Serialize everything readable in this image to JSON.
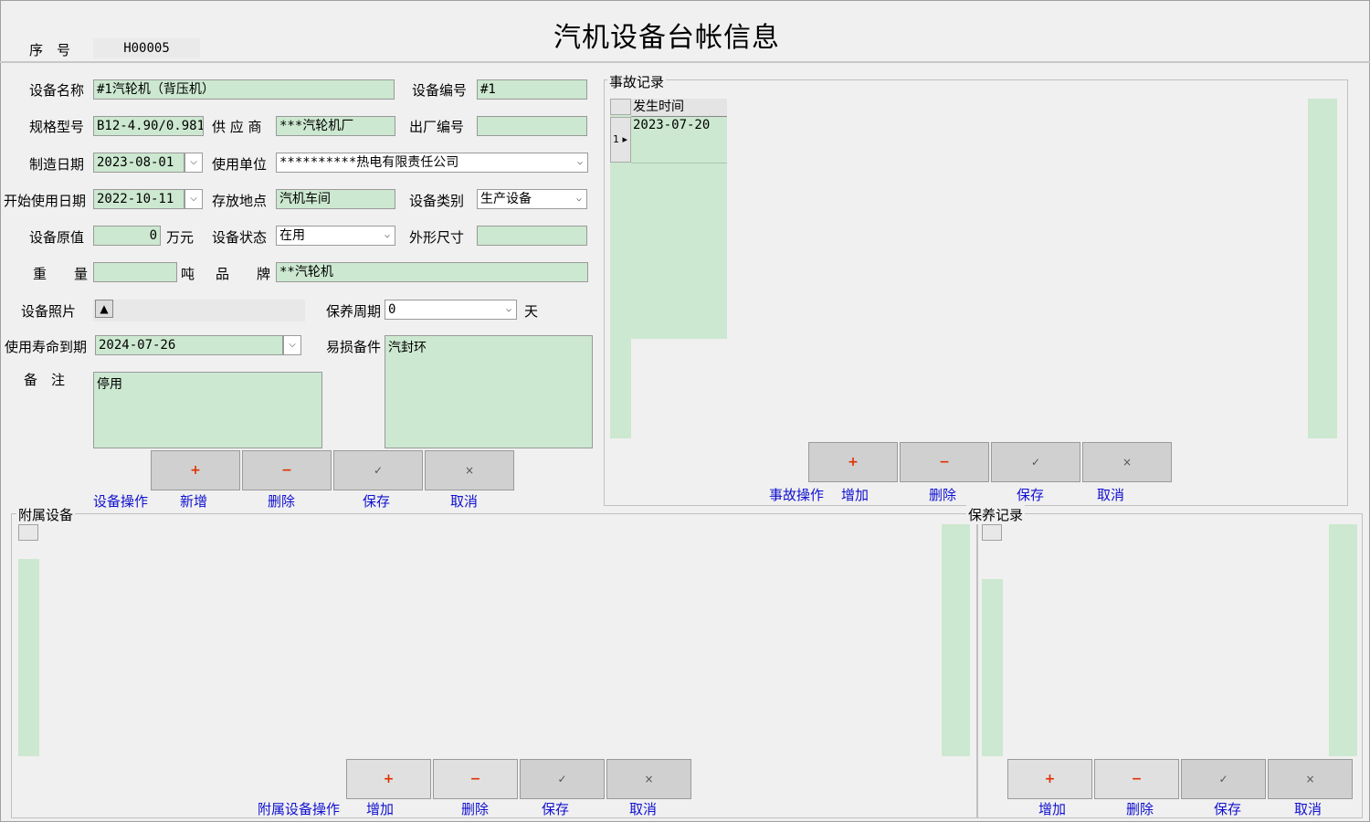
{
  "title": "汽机设备台帐信息",
  "seq": {
    "label": "序　号",
    "value": "H00005"
  },
  "form": {
    "device_name": {
      "label": "设备名称",
      "value": "#1汽轮机（背压机）"
    },
    "device_no": {
      "label": "设备编号",
      "value": "#1"
    },
    "spec": {
      "label": "规格型号",
      "value": "B12-4.90/0.981"
    },
    "supplier": {
      "label": "供 应 商",
      "value": "***汽轮机厂"
    },
    "factory_no": {
      "label": "出厂编号",
      "value": ""
    },
    "mfg_date": {
      "label": "制造日期",
      "value": "2023-08-01"
    },
    "use_unit": {
      "label": "使用单位",
      "value": "**********热电有限责任公司"
    },
    "start_date": {
      "label": "开始使用日期",
      "value": "2022-10-11"
    },
    "location": {
      "label": "存放地点",
      "value": "汽机车间"
    },
    "category": {
      "label": "设备类别",
      "value": "生产设备"
    },
    "orig_value": {
      "label": "设备原值",
      "value": "0",
      "unit": "万元"
    },
    "status": {
      "label": "设备状态",
      "value": "在用"
    },
    "dimensions": {
      "label": "外形尺寸",
      "value": ""
    },
    "weight": {
      "label": "重　　量",
      "value": "",
      "unit": "吨"
    },
    "brand": {
      "label": "品　　牌",
      "value": "**汽轮机"
    },
    "photo": {
      "label": "设备照片",
      "icon": "up-triangle-icon"
    },
    "maint_cycle": {
      "label": "保养周期",
      "value": "0",
      "unit": "天"
    },
    "life_end": {
      "label": "使用寿命到期",
      "value": "2024-07-26"
    },
    "wear_parts": {
      "label": "易损备件",
      "value": "汽封环"
    },
    "remark": {
      "label": "备　注",
      "value": "停用"
    }
  },
  "device_ops": {
    "label": "设备操作",
    "buttons": [
      "新增",
      "删除",
      "保存",
      "取消"
    ]
  },
  "accident": {
    "title": "事故记录",
    "column": "发生时间",
    "rows": [
      {
        "index": "1",
        "time": "2023-07-20"
      }
    ],
    "ops_label": "事故操作",
    "buttons": [
      "增加",
      "删除",
      "保存",
      "取消"
    ]
  },
  "attached": {
    "title": "附属设备",
    "ops_label": "附属设备操作",
    "buttons": [
      "增加",
      "删除",
      "保存",
      "取消"
    ]
  },
  "maintenance": {
    "title": "保养记录",
    "buttons": [
      "增加",
      "删除",
      "保存",
      "取消"
    ]
  },
  "symbols": {
    "add": "+",
    "remove": "−",
    "save": "✓",
    "cancel": "×"
  },
  "colors": {
    "field_bg": "#cce8d0",
    "link_text": "#1010d0",
    "button_bg": "#d0d0d0",
    "add_remove_symbol": "#e03000"
  }
}
